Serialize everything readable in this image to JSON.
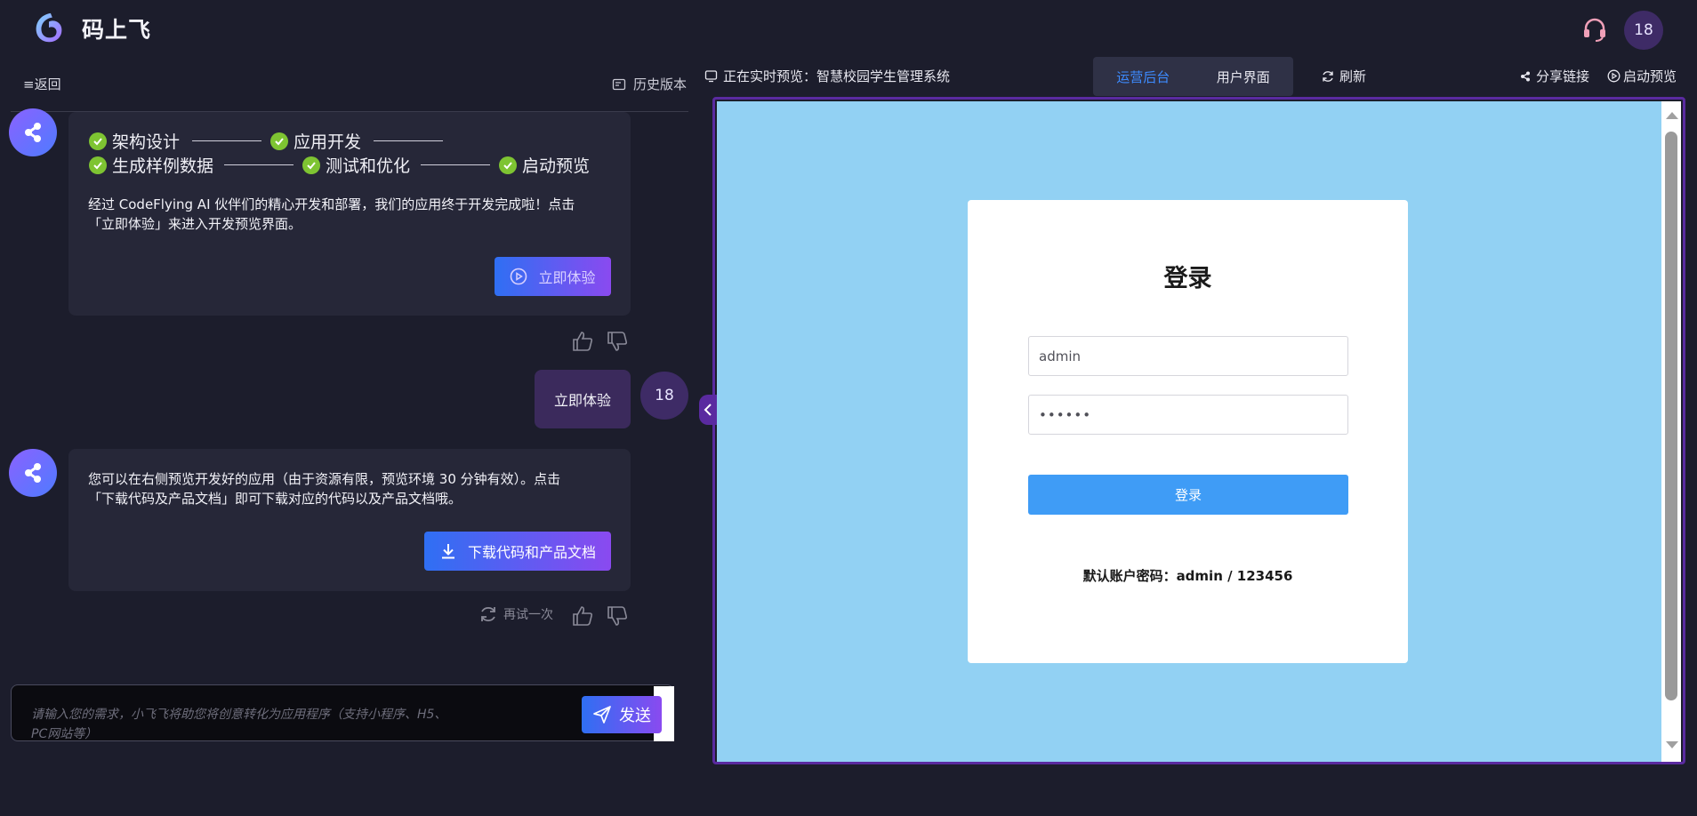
{
  "app": {
    "name": "码上飞",
    "user_badge": "18"
  },
  "left_panel": {
    "back_label": "≡返回",
    "history_label": "历史版本",
    "steps_row1": [
      "架构设计",
      "应用开发"
    ],
    "steps_row2": [
      "生成样例数据",
      "测试和优化",
      "启动预览"
    ],
    "message1": {
      "line1": "经过 CodeFlying AI 伙伴们的精心开发和部署，我们的应用终于开发完成啦！点击",
      "line2": "「立即体验」来进入开发预览界面。",
      "button_label": "立即体验"
    },
    "user_message": {
      "text": "立即体验",
      "avatar": "18"
    },
    "message2": {
      "line1": "您可以在右侧预览开发好的应用（由于资源有限，预览环境 30 分钟有效）。点击",
      "line2": "「下载代码及产品文档」即可下载对应的代码以及产品文档哦。",
      "button_label": "下载代码和产品文档",
      "retry_label": "再试一次"
    },
    "input": {
      "placeholder_line1": "请输入您的需求，小飞飞将助您将创意转化为应用程序（支持小程序、H5、",
      "placeholder_line2": "PC网站等）",
      "send_label": "发送"
    }
  },
  "preview_header": {
    "live_label": "正在实时预览：智慧校园学生管理系统",
    "segments": [
      "运营后台",
      "用户界面"
    ],
    "active_segment": "运营后台",
    "refresh_label": "刷新",
    "share_label": "分享链接",
    "launch_label": "启动预览"
  },
  "preview": {
    "background": "#92d1f3",
    "login": {
      "title": "登录",
      "username_value": "admin",
      "password_value": "••••••",
      "button_label": "登录",
      "hint": "默认账户密码：admin / 123456"
    }
  },
  "colors": {
    "accent_blue": "#3d8bff",
    "check_green": "#7ec432",
    "frame_purple": "#5a2aa0",
    "login_button": "#3f9cf6"
  }
}
